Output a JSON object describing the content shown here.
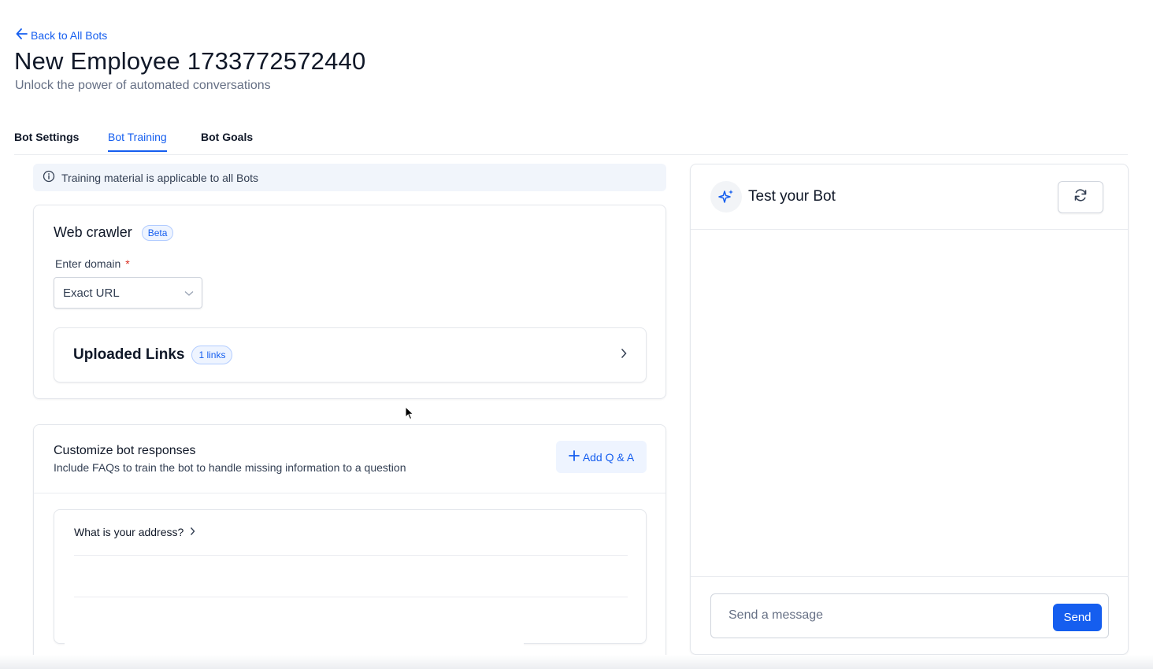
{
  "header": {
    "back_label": "Back to All Bots",
    "title": "New Employee 1733772572440",
    "subtitle": "Unlock the power of automated conversations"
  },
  "tabs": [
    {
      "label": "Bot Settings",
      "active": false
    },
    {
      "label": "Bot Training",
      "active": true
    },
    {
      "label": "Bot Goals",
      "active": false
    }
  ],
  "info_banner": {
    "text": "Training material is applicable to all Bots",
    "icon": "info-icon"
  },
  "web_crawler": {
    "title": "Web crawler",
    "badge": "Beta",
    "domain_label": "Enter domain",
    "required_mark": "*",
    "domain_select_value": "Exact URL",
    "uploaded_links": {
      "label": "Uploaded Links",
      "count_badge": "1 links"
    }
  },
  "faq": {
    "title": "Customize bot responses",
    "description": "Include FAQs to train the bot to handle missing information to a question",
    "add_button_label": "Add Q & A",
    "items": [
      {
        "question": "What is your address?"
      }
    ]
  },
  "test_panel": {
    "title": "Test your Bot",
    "message_placeholder": "Send a message",
    "send_label": "Send"
  },
  "colors": {
    "accent": "#155eef",
    "text": "#101828",
    "muted": "#667085",
    "border": "#e4e7ec"
  }
}
